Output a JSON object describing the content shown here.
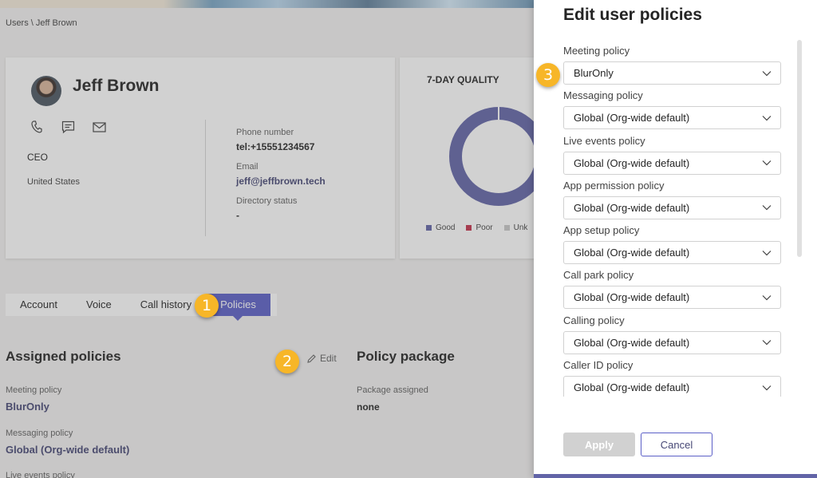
{
  "breadcrumb": "Users \\ Jeff Brown",
  "profile": {
    "name": "Jeff Brown",
    "job_title": "CEO",
    "country": "United States",
    "phone_label": "Phone number",
    "phone_value": "tel:+15551234567",
    "email_label": "Email",
    "email_value": "jeff@jeffbrown.tech",
    "directory_label": "Directory status",
    "directory_value": "-",
    "contact_icons": [
      "phone-icon",
      "chat-icon",
      "mail-icon"
    ]
  },
  "quality": {
    "title": "7-DAY QUALITY",
    "legend": [
      {
        "label": "Good",
        "color": "#6264a7"
      },
      {
        "label": "Poor",
        "color": "#c4314b"
      },
      {
        "label": "Unk",
        "color": "#c8c8c8"
      }
    ]
  },
  "tabs": [
    "Account",
    "Voice",
    "Call history",
    "Policies"
  ],
  "active_tab": "Policies",
  "assigned": {
    "title": "Assigned policies",
    "edit_label": "Edit",
    "items": [
      {
        "label": "Meeting policy",
        "value": "BlurOnly"
      },
      {
        "label": "Messaging policy",
        "value": "Global (Org-wide default)"
      },
      {
        "label": "Live events policy",
        "value": ""
      }
    ]
  },
  "package": {
    "title": "Policy package",
    "label": "Package assigned",
    "value": "none"
  },
  "callouts": [
    "1",
    "2",
    "3"
  ],
  "panel": {
    "title": "Edit user policies",
    "policies": [
      {
        "label": "Meeting policy",
        "value": "BlurOnly"
      },
      {
        "label": "Messaging policy",
        "value": "Global (Org-wide default)"
      },
      {
        "label": "Live events policy",
        "value": "Global (Org-wide default)"
      },
      {
        "label": "App permission policy",
        "value": "Global (Org-wide default)"
      },
      {
        "label": "App setup policy",
        "value": "Global (Org-wide default)"
      },
      {
        "label": "Call park policy",
        "value": "Global (Org-wide default)"
      },
      {
        "label": "Calling policy",
        "value": "Global (Org-wide default)"
      },
      {
        "label": "Caller ID policy",
        "value": "Global (Org-wide default)"
      }
    ],
    "apply_label": "Apply",
    "cancel_label": "Cancel"
  },
  "colors": {
    "accent": "#5b5fc7",
    "callout": "#f7b628",
    "link": "#464775"
  }
}
